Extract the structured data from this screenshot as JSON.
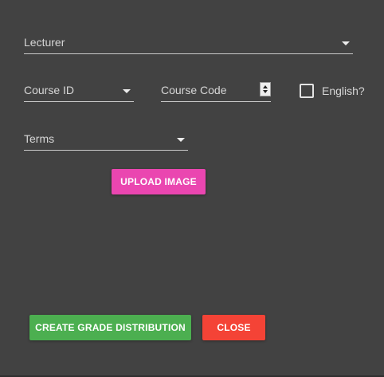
{
  "form": {
    "lecturer": {
      "label": "Lecturer",
      "icon": "arrow-drop-down-icon"
    },
    "course_id": {
      "label": "Course ID",
      "icon": "arrow-drop-down-icon"
    },
    "course_code": {
      "label": "Course Code",
      "icon": "number-stepper-icon"
    },
    "english": {
      "label": "English?",
      "checked": false
    },
    "terms": {
      "label": "Terms",
      "icon": "arrow-drop-down-icon"
    }
  },
  "buttons": {
    "upload_image": "UPLOAD IMAGE",
    "create_grade_distribution": "CREATE GRADE DISTRIBUTION",
    "close": "CLOSE"
  },
  "colors": {
    "background": "#424242",
    "upload_button": "#ea46b0",
    "create_button": "#4caf50",
    "close_button": "#f44336"
  }
}
